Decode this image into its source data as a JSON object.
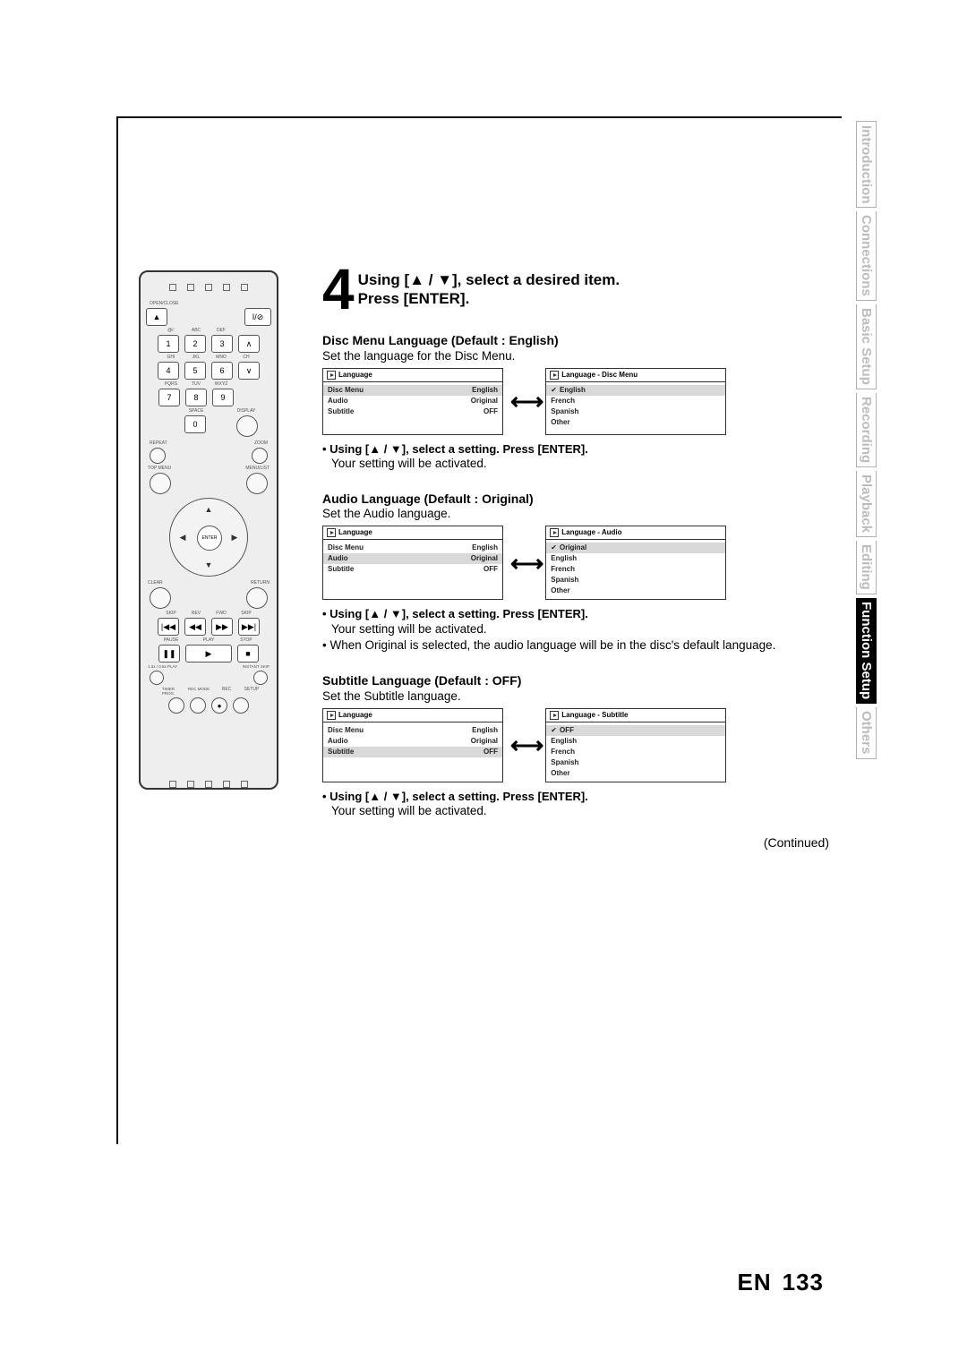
{
  "tabs": {
    "t1": "Introduction",
    "t2": "Connections",
    "t3": "Basic Setup",
    "t4": "Recording",
    "t5": "Playback",
    "t6": "Editing",
    "t7": "Function Setup",
    "t8": "Others"
  },
  "remote": {
    "lbl_openclose": "OPEN/CLOSE",
    "power": "I/⊘",
    "num_abc": "ABC",
    "num_def": "DEF",
    "num_ghi": "GHI",
    "num_jkl": "JKL",
    "num_mno": "MNO",
    "num_ch": "CH",
    "num_pqrs": "PQRS",
    "num_tuv": "TUV",
    "num_wxyz": "WXYZ",
    "num_space": "SPACE",
    "num_at": "@/:",
    "display": "DISPLAY",
    "repeat": "REPEAT",
    "zoom": "ZOOM",
    "topmenu": "TOP MENU",
    "menulist": "MENU/LIST",
    "enter": "ENTER",
    "clear": "CLEAR",
    "ret": "RETURN",
    "skip": "SKIP",
    "rev": "REV",
    "fwd": "FWD",
    "pause": "PAUSE",
    "play": "PLAY",
    "stop": "STOP",
    "speed": "1.3x / 0.8x PLAY",
    "instant": "INSTANT SKIP",
    "timer": "TIMER PROG.",
    "recmode": "REC MODE",
    "rec": "REC",
    "setup": "SETUP",
    "n1": "1",
    "n2": "2",
    "n3": "3",
    "n4": "4",
    "n5": "5",
    "n6": "6",
    "n7": "7",
    "n8": "8",
    "n9": "9",
    "n0": "0"
  },
  "step": {
    "num": "4",
    "line1": "Using [▲ / ▼], select a desired item.",
    "line2": "Press [ENTER]."
  },
  "disc": {
    "heading": "Disc Menu Language (Default : English)",
    "desc": "Set the language for the Disc Menu.",
    "left": {
      "title": "Language",
      "r1a": "Disc Menu",
      "r1b": "English",
      "r2a": "Audio",
      "r2b": "Original",
      "r3a": "Subtitle",
      "r3b": "OFF"
    },
    "right": {
      "title": "Language - Disc Menu",
      "o1": "English",
      "o2": "French",
      "o3": "Spanish",
      "o4": "Other"
    },
    "bullet": "• Using [▲ / ▼], select a setting. Press [ENTER].",
    "activated": "Your setting will be activated."
  },
  "audio": {
    "heading": "Audio Language (Default : Original)",
    "desc": "Set the Audio language.",
    "left": {
      "title": "Language",
      "r1a": "Disc Menu",
      "r1b": "English",
      "r2a": "Audio",
      "r2b": "Original",
      "r3a": "Subtitle",
      "r3b": "OFF"
    },
    "right": {
      "title": "Language - Audio",
      "o1": "Original",
      "o2": "English",
      "o3": "French",
      "o4": "Spanish",
      "o5": "Other"
    },
    "bullet": "• Using [▲ / ▼], select a setting. Press [ENTER].",
    "activated": "Your setting will be activated.",
    "note": "• When Original is selected, the audio language will be in the disc's default language."
  },
  "subtitle": {
    "heading": "Subtitle Language (Default : OFF)",
    "desc": "Set the Subtitle language.",
    "left": {
      "title": "Language",
      "r1a": "Disc Menu",
      "r1b": "English",
      "r2a": "Audio",
      "r2b": "Original",
      "r3a": "Subtitle",
      "r3b": "OFF"
    },
    "right": {
      "title": "Language - Subtitle",
      "o1": "OFF",
      "o2": "English",
      "o3": "French",
      "o4": "Spanish",
      "o5": "Other"
    },
    "bullet": "• Using [▲ / ▼], select a setting. Press [ENTER].",
    "activated": "Your setting will be activated."
  },
  "continued": "(Continued)",
  "page": {
    "lang": "EN",
    "num": "133"
  },
  "arrow": "⟷"
}
